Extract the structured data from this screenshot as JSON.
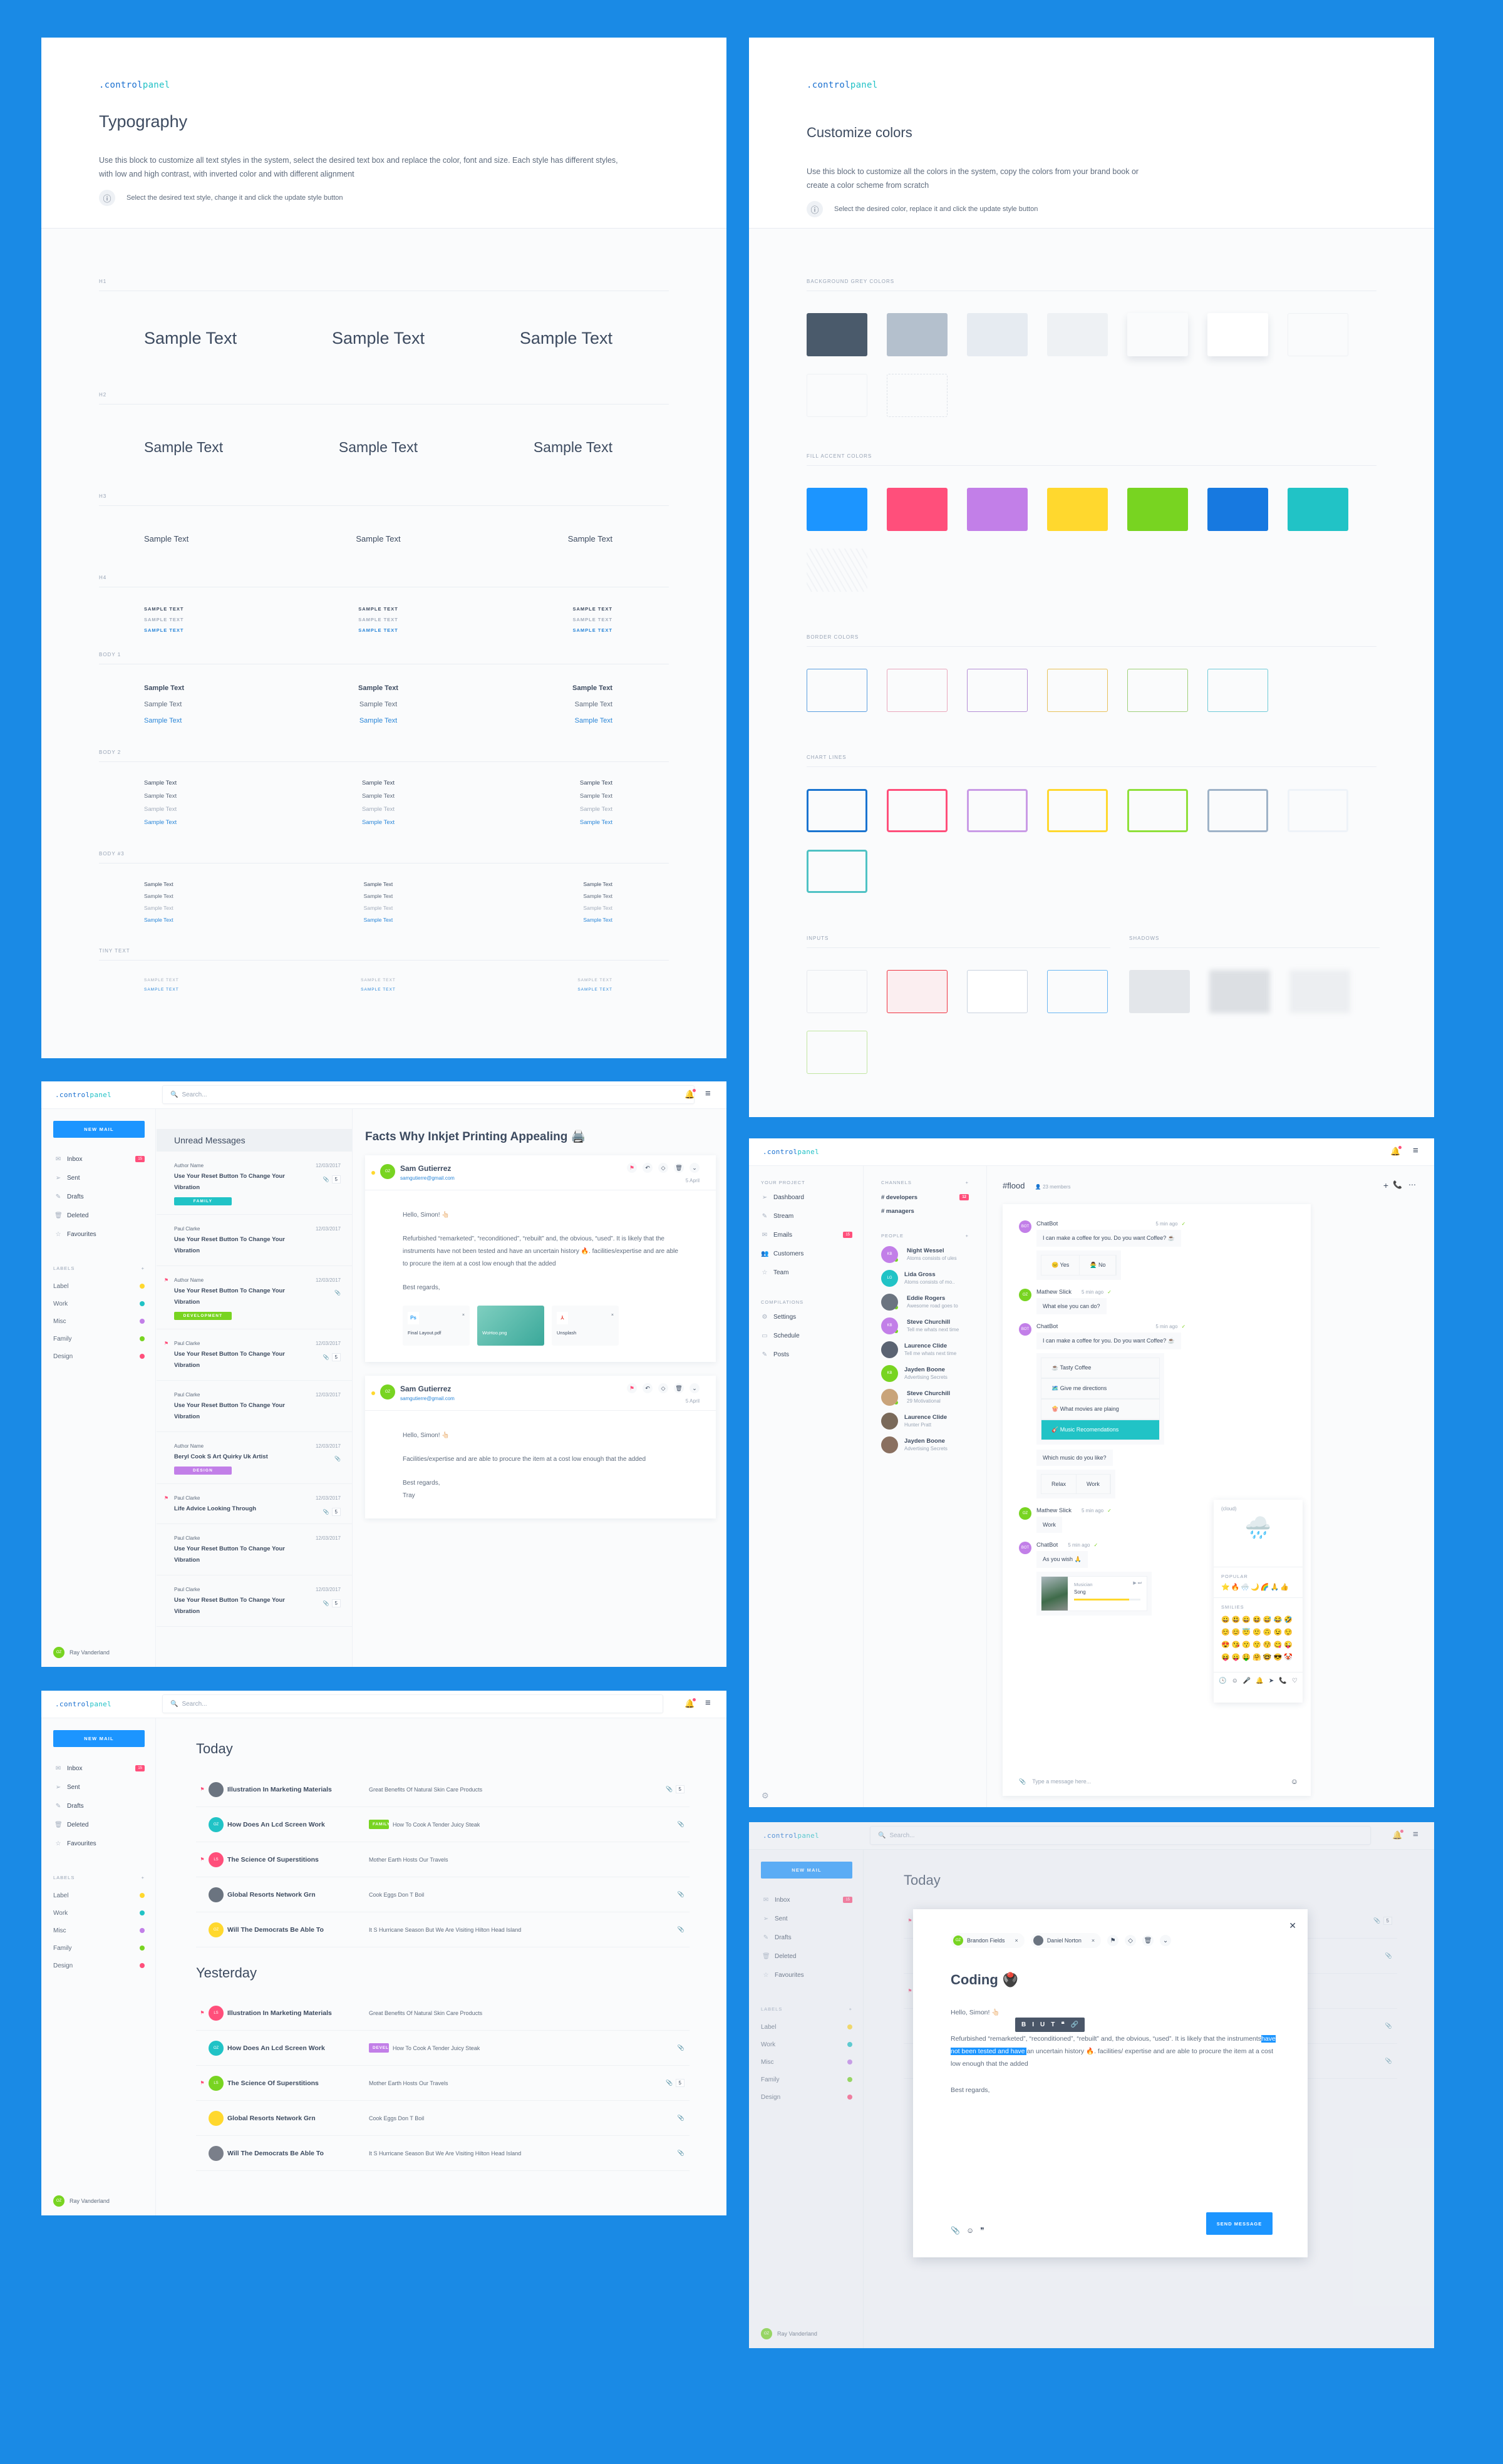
{
  "brand": {
    "logo_part1": ".control",
    "logo_part2": "panel"
  },
  "typography": {
    "title": "Typography",
    "description": "Use this block to customize all text styles in the system, select the desired text box and replace the color, font and size. Each style has different styles, with low and high contrast, with inverted color and with different alignment",
    "hint": "Select the desired text style, change it and click the update style button",
    "sample": "Sample Text",
    "sample_upper": "SAMPLE TEXT",
    "sections": [
      {
        "label": "H1"
      },
      {
        "label": "H2"
      },
      {
        "label": "H3"
      },
      {
        "label": "H4"
      },
      {
        "label": "BODY 1"
      },
      {
        "label": "BODY 2"
      },
      {
        "label": "BODY #3"
      },
      {
        "label": "TINY TEXT"
      }
    ]
  },
  "colors": {
    "title": "Customize colors",
    "description": "Use this block to customize all the colors in the system, copy the colors from your brand book or create a color scheme from scratch",
    "hint": "Select the desired color, replace it and click the update style button",
    "sections": {
      "background": {
        "label": "BACKGROUND GREY COLORS",
        "swatches": [
          "#4a5a6b",
          "#b4c0cd",
          "#e6ebf1",
          "#eef1f4",
          "#fafbfc",
          "#ffffff",
          "#fafbfc",
          "#fafbfc",
          "#fafbfc"
        ]
      },
      "accent": {
        "label": "FILL ACCENT COLORS",
        "swatches": [
          "#1c95ff",
          "#ff4f7b",
          "#c27fe8",
          "#ffd82e",
          "#78d421",
          "#1779e0",
          "#21c3c6"
        ]
      },
      "border": {
        "label": "BORDER COLORS",
        "swatches": [
          "#5a9ee0",
          "#e9a6bc",
          "#b48ed6",
          "#e7c15a",
          "#9fd07a",
          "#6fcbd8"
        ]
      },
      "chart": {
        "label": "CHART LINES",
        "swatches": [
          "#1a74d0",
          "#ff4f7b",
          "#c99be6",
          "#ffd82e",
          "#8fe03a",
          "#9fb3c8",
          "#eef3f8",
          "#4fc2c4"
        ]
      },
      "inputs": {
        "label": "INPUTS",
        "swatches": [
          "#e6e9ee",
          "#ef3240",
          "#c9d3df",
          "#6ab6f2",
          "#c1e6a1"
        ]
      },
      "shadows": {
        "label": "SHADOWS"
      }
    }
  },
  "mail1": {
    "search_placeholder": "Search...",
    "new_mail": "NEW MAIL",
    "nav": [
      {
        "label": "Inbox",
        "icon": "inbox-icon",
        "badge": "15"
      },
      {
        "label": "Sent",
        "icon": "send-icon"
      },
      {
        "label": "Drafts",
        "icon": "pencil-icon"
      },
      {
        "label": "Deleted",
        "icon": "trash-icon"
      },
      {
        "label": "Favourites",
        "icon": "star-icon"
      }
    ],
    "labels_title": "LABELS",
    "labels": [
      {
        "name": "Label",
        "color": "#ffd82e"
      },
      {
        "name": "Work",
        "color": "#21c3c6"
      },
      {
        "name": "Misc",
        "color": "#c27fe8"
      },
      {
        "name": "Family",
        "color": "#78d421"
      },
      {
        "name": "Design",
        "color": "#ff4f7b"
      }
    ],
    "user": {
      "initials": "OZ",
      "name": "Ray Vanderland"
    },
    "list_title": "Unread Messages",
    "messages": [
      {
        "author": "Author Name",
        "date": "12/03/2017",
        "subject": "Use Your Reset Button To Change Your Vibration",
        "attach": "5",
        "tag": "FAMILY",
        "tag_color": "#21c3c6",
        "flag": false
      },
      {
        "author": "Paul Clarke",
        "date": "12/03/2017",
        "subject": "Use Your Reset Button To Change Your Vibration",
        "flag": false
      },
      {
        "author": "Author Name",
        "date": "12/03/2017",
        "subject": "Use Your Reset Button To Change Your Vibration",
        "attach": "",
        "tag": "DEVELOPMENT",
        "tag_color": "#78d421",
        "flag": true
      },
      {
        "author": "Paul Clarke",
        "date": "12/03/2017",
        "subject": "Use Your Reset Button To Change Your Vibration",
        "attach": "5",
        "flag": true
      },
      {
        "author": "Paul Clarke",
        "date": "12/03/2017",
        "subject": "Use Your Reset Button To Change Your Vibration",
        "flag": false
      },
      {
        "author": "Author Name",
        "date": "12/03/2017",
        "subject": "Beryl Cook S Art Quirky Uk Artist",
        "attach": "",
        "tag": "DESIGN",
        "tag_color": "#c27fe8",
        "flag": false
      },
      {
        "author": "Paul Clarke",
        "date": "12/03/2017",
        "subject": "Life Advice Looking Through",
        "attach": "5",
        "flag": true
      },
      {
        "author": "Paul Clarke",
        "date": "12/03/2017",
        "subject": "Use Your Reset Button To Change Your Vibration",
        "flag": false
      },
      {
        "author": "Paul Clarke",
        "date": "12/03/2017",
        "subject": "Use Your Reset Button To Change Your Vibration",
        "attach": "5",
        "flag": false
      }
    ],
    "reader": {
      "title": "Facts Why Inkjet  Printing Appealing 🖨️",
      "emails": [
        {
          "initials": "OZ",
          "name": "Sam Gutierrez",
          "email": "samgutierre@gmail.com",
          "date": "5 April",
          "greeting": "Hello, Simon! 👆🏻",
          "body": "Refurbished  “remarketed”, “reconditioned”, “rebuilt” and, the obvious, “used”. It is likely that the instruments have not been tested and have an uncertain history 🔥.  facilities/expertise and are able to procure the item at a cost low enough that the added",
          "sign": "Best regards,",
          "attachments": [
            {
              "name": "Final Layout.pdf",
              "type": "Ps"
            },
            {
              "name": "WoHoo.png",
              "type": "image"
            },
            {
              "name": "Unsplash",
              "type": "pdf"
            }
          ]
        },
        {
          "initials": "OZ",
          "name": "Sam Gutierrez",
          "email": "samgutierre@gmail.com",
          "date": "5 April",
          "greeting": "Hello, Simon! 👆🏻",
          "body": "Facilities/expertise and are able to procure the item at a cost low enough that the added",
          "sign": "Best regards,",
          "sign2": "Tray"
        }
      ]
    }
  },
  "chat": {
    "project_title": "YOUR PROJECT",
    "project_nav": [
      {
        "label": "Dashboard",
        "icon": "send-icon"
      },
      {
        "label": "Stream",
        "icon": "pencil-icon"
      },
      {
        "label": "Emails",
        "icon": "inbox-icon",
        "badge": "15"
      },
      {
        "label": "Customers",
        "icon": "users-icon"
      },
      {
        "label": "Team",
        "icon": "star-icon"
      }
    ],
    "compilations_title": "COMPILATIONS",
    "compilations": [
      {
        "label": "Settings",
        "icon": "gear-icon"
      },
      {
        "label": "Schedule",
        "icon": "calendar-icon"
      },
      {
        "label": "Posts",
        "icon": "pencil-icon"
      }
    ],
    "channels_title": "CHANNELS",
    "channels": [
      {
        "name": "# developers",
        "badge": "12"
      },
      {
        "name": "# managers"
      }
    ],
    "people_title": "PEOPLE",
    "people": [
      {
        "name": "Night Wessel",
        "status": "Atoms consists of ules",
        "initials": "KB",
        "color": "#c27fe8",
        "online": true
      },
      {
        "name": "Lida Gross",
        "status": "Atoms consists of mo..",
        "initials": "LG",
        "color": "#21c3c6",
        "online": false
      },
      {
        "name": "Eddie Rogers",
        "status": "Awesome road goes to",
        "initials": "",
        "color": "#6b7480",
        "online": true
      },
      {
        "name": "Steve Churchill",
        "status": "Tell me whats next time",
        "initials": "KB",
        "color": "#c27fe8",
        "online": true
      },
      {
        "name": "Laurence Clide",
        "status": "Tell me whats next time",
        "initials": "",
        "color": "#5a6372",
        "online": false
      },
      {
        "name": "Jayden Boone",
        "status": "Advertising Secrets",
        "initials": "KB",
        "color": "#78d421",
        "online": false
      },
      {
        "name": "Steve Churchill",
        "status": "29 Motivational",
        "initials": "",
        "color": "#c9a47a",
        "online": true
      },
      {
        "name": "Laurence Clide",
        "status": "Hunter Pratt",
        "initials": "",
        "color": "#7a6a5a",
        "online": false
      },
      {
        "name": "Jayden Boone",
        "status": "Advertising Secrets",
        "initials": "",
        "color": "#8a7060",
        "online": false
      }
    ],
    "channel": "#flood",
    "members": "23 members",
    "messages": [
      {
        "author": "ChatBot",
        "initials": "BOT",
        "time": "5 min ago",
        "text": "I can make a coffee for you. Do you want Coffee? ☕",
        "options": [
          "😐 Yes",
          "🙅‍♂️ No"
        ]
      },
      {
        "author": "Mathew Slick",
        "initials": "OZ",
        "time": "5 min ago",
        "text": "What else you can do?"
      },
      {
        "author": "ChatBot",
        "initials": "BOT",
        "time": "5 min ago",
        "text": "I can make a coffee for you. Do you want Coffee? ☕",
        "menu": [
          "☕ Tasty Coffee",
          "🗺️ Give me directions",
          "🍿 What movies are plaing",
          "🎸 Music Recomendations"
        ],
        "menu_active": 3,
        "followup": "Which music do you like?",
        "options2": [
          "Relax",
          "Work"
        ]
      },
      {
        "author": "Mathew Slick",
        "initials": "OZ",
        "time": "5 min ago",
        "text": "Work"
      },
      {
        "author": "ChatBot",
        "initials": "BOT",
        "time": "5 min ago",
        "text": "As you wish 🙏",
        "player": {
          "artist": "Musician",
          "song": "Song",
          "progress": 0.83
        }
      }
    ],
    "input_placeholder": "Type a message here...",
    "emoji": {
      "preview_name": "(cloud)",
      "preview": "🌧️",
      "popular_title": "POPULAR",
      "popular": "⭐🔥🌨️🌙🌈🙏👍",
      "smilies_title": "SMILIES",
      "smilies": [
        "😀😃😄😆😅😂🤣",
        "☺️😊😇🙂🙃😉😌",
        "😍😘😗😙😚😋😜",
        "😝😛🤑🤗🤓😎🤡"
      ]
    }
  },
  "mail2": {
    "search_placeholder": "Search...",
    "today": "Today",
    "yesterday": "Yesterday",
    "today_rows": [
      {
        "title": "Illustration In Marketing Materials",
        "snippet": "Great Benefits Of Natural Skin Care Products",
        "flag": true,
        "avatar": "photo",
        "color": "#6b7480",
        "attach": "5"
      },
      {
        "title": "How Does An Lcd Screen Work",
        "snippet": "How To Cook A Tender Juicy Steak",
        "flag": false,
        "avatar": "OZ",
        "color": "#21c3c6",
        "tag": "FAMILY",
        "tag_color": "#78d421",
        "attach": ""
      },
      {
        "title": "The Science Of Superstitions",
        "snippet": "Mother Earth Hosts Our Travels",
        "flag": true,
        "avatar": "LS",
        "color": "#ff4f7b"
      },
      {
        "title": "Global Resorts Network Grn",
        "snippet": "Cook Eggs Don T Boil",
        "flag": false,
        "avatar": "photo",
        "color": "#6b7480",
        "attach": ""
      },
      {
        "title": "Will The Democrats Be Able To",
        "snippet": "It S Hurricane Season But We Are Visiting Hilton Head Island",
        "flag": false,
        "avatar": "OZ",
        "color": "#ffd82e",
        "attach": ""
      }
    ],
    "yesterday_rows": [
      {
        "title": "Illustration In Marketing Materials",
        "snippet": "Great Benefits Of Natural Skin Care Products",
        "flag": true,
        "avatar": "LS",
        "color": "#ff4f7b"
      },
      {
        "title": "How Does An Lcd Screen Work",
        "snippet": "How To Cook A Tender Juicy Steak",
        "flag": false,
        "avatar": "OZ",
        "color": "#21c3c6",
        "tag": "DEVELOPM..",
        "tag_color": "#c27fe8",
        "attach": ""
      },
      {
        "title": "The Science Of Superstitions",
        "snippet": "Mother Earth Hosts Our Travels",
        "flag": true,
        "avatar": "LS",
        "color": "#78d421",
        "attach": "5"
      },
      {
        "title": "Global Resorts Network Grn",
        "snippet": "Cook Eggs Don T Boil",
        "flag": false,
        "avatar": "photo",
        "color": "#ffd82e",
        "attach": ""
      },
      {
        "title": "Will The Democrats Be Able To",
        "snippet": "It S Hurricane Season But We Are Visiting Hilton Head Island",
        "flag": false,
        "avatar": "photo",
        "color": "#7a7f8a",
        "attach": ""
      }
    ]
  },
  "compose": {
    "recipients": [
      {
        "name": "Brandon Fields",
        "initials": "OZ",
        "color": "#78d421"
      },
      {
        "name": "Daniel Norton",
        "initials": "",
        "color": "#6b7480"
      }
    ],
    "subject": "Coding 🖲️",
    "greeting": "Hello, Simon! 👆🏻",
    "body_before": "Refurbished  “remarketed”, “reconditioned”, “rebuilt” and, the obvious, “used”. It is likely that the instruments",
    "body_selected": "have not been tested and have ",
    "body_after": " an uncertain history 🔥.  facilities/ expertise and are able to procure the item at a cost low enough that the added",
    "sign": "Best regards,",
    "format_buttons": [
      "B",
      "I",
      "U",
      "T",
      "❝",
      "🔗"
    ],
    "send": "SEND MESSAGE"
  }
}
